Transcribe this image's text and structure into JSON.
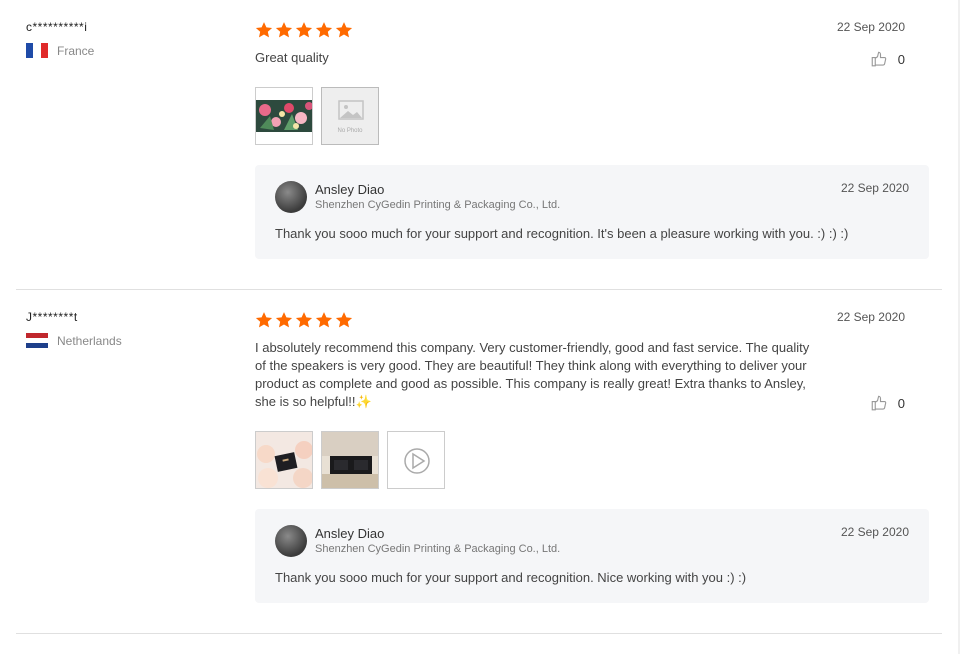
{
  "reviews": [
    {
      "user": "c**********i",
      "country": "France",
      "stars": 5,
      "date": "22 Sep 2020",
      "text": "Great quality",
      "likes": "0",
      "photos": [
        "flowers-photo",
        "no-photo"
      ],
      "no_photo_label": "No Photo",
      "reply": {
        "name": "Ansley Diao",
        "company": "Shenzhen CyGedin Printing & Packaging Co., Ltd.",
        "date": "22 Sep 2020",
        "text": "Thank you sooo much for your support and recognition. It's been a pleasure working with you. :) :) :)"
      }
    },
    {
      "user": "J********t",
      "country": "Netherlands",
      "stars": 5,
      "date": "22 Sep 2020",
      "text": "I absolutely recommend this company. Very customer-friendly, good and fast service. The quality of the speakers is very good. They are beautiful! They think along with everything to deliver your product as complete and good as possible. This company is really great! Extra thanks to Ansley, she is so helpful!!✨",
      "likes": "0",
      "photos": [
        "box-photo",
        "product-photo",
        "video"
      ],
      "reply": {
        "name": "Ansley Diao",
        "company": "Shenzhen CyGedin Printing & Packaging Co., Ltd.",
        "date": "22 Sep 2020",
        "text": "Thank you sooo much for your support and recognition. Nice working with you :) :)"
      }
    }
  ],
  "colors": {
    "star": "#ff6a00",
    "reply_bg": "#f5f6f8"
  }
}
